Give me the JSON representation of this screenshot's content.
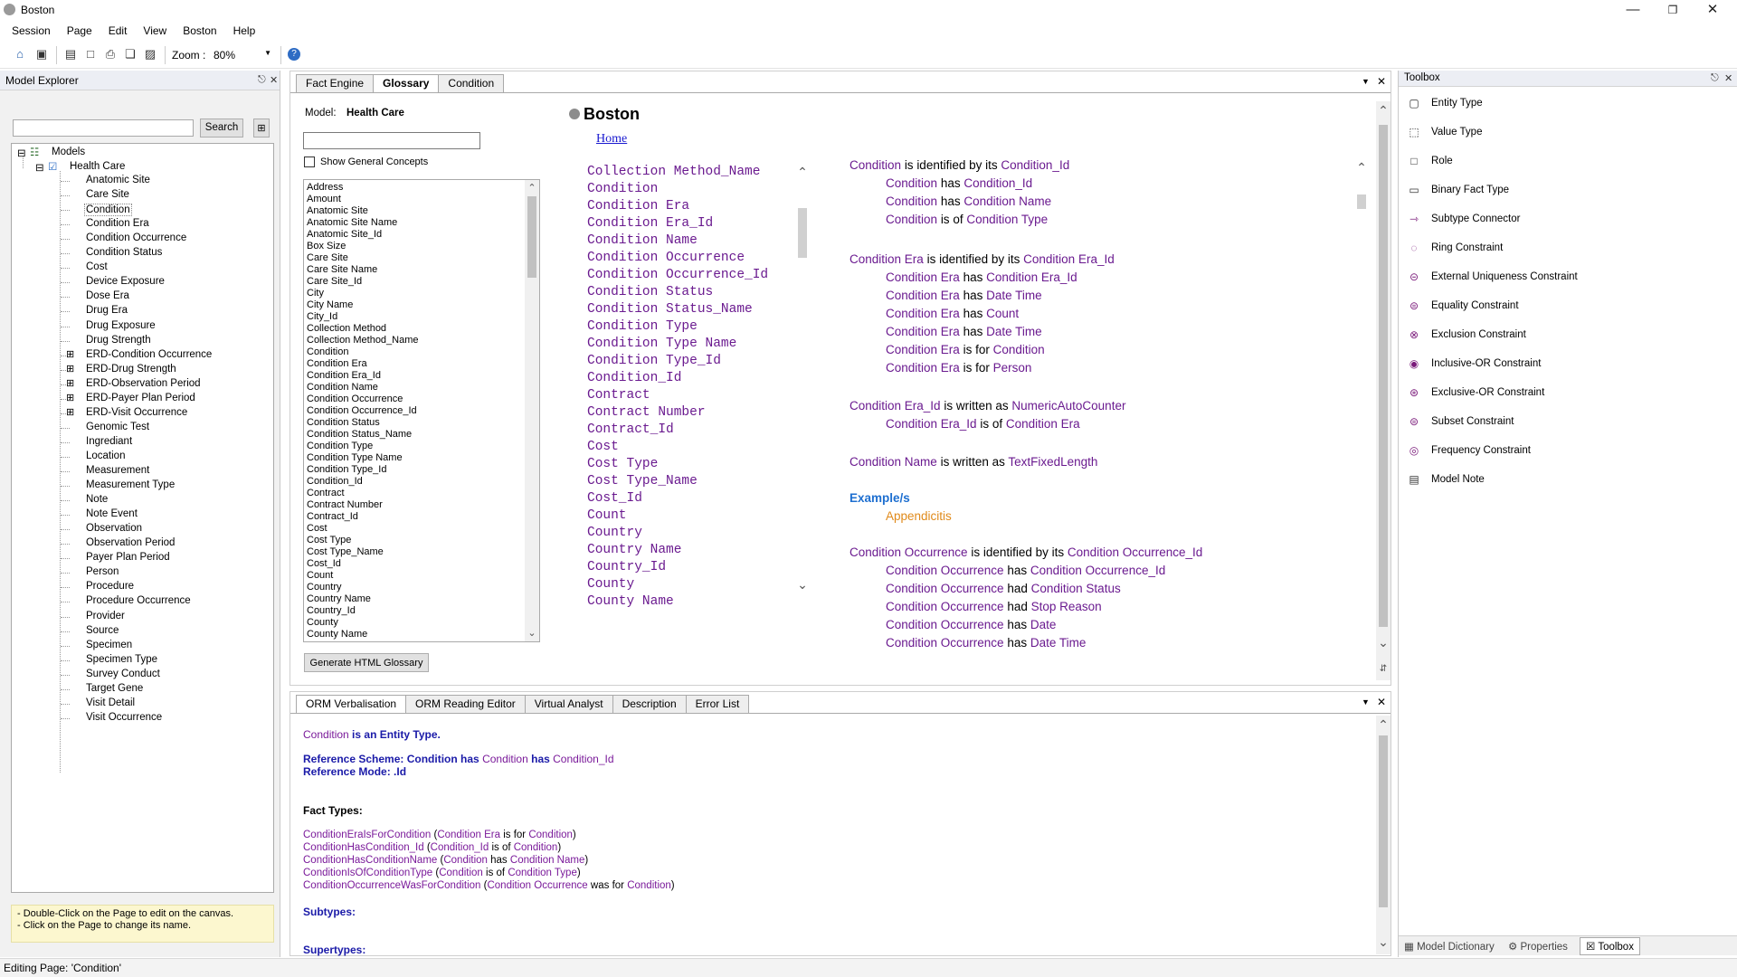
{
  "window": {
    "title": "Boston"
  },
  "menu": [
    "Session",
    "Page",
    "Edit",
    "View",
    "Boston",
    "Help"
  ],
  "toolbar": {
    "zoom_label": "Zoom :",
    "zoom_value": "80%"
  },
  "explorer": {
    "title": "Model Explorer",
    "search_button": "Search",
    "search_value": "",
    "root": "Models",
    "model": "Health Care",
    "items": [
      {
        "label": "Anatomic Site",
        "erd": false
      },
      {
        "label": "Care Site",
        "erd": false
      },
      {
        "label": "Condition",
        "erd": false
      },
      {
        "label": "Condition Era",
        "erd": false
      },
      {
        "label": "Condition Occurrence",
        "erd": false
      },
      {
        "label": "Condition Status",
        "erd": false
      },
      {
        "label": "Cost",
        "erd": false
      },
      {
        "label": "Device Exposure",
        "erd": false
      },
      {
        "label": "Dose Era",
        "erd": false
      },
      {
        "label": "Drug Era",
        "erd": false
      },
      {
        "label": "Drug Exposure",
        "erd": false
      },
      {
        "label": "Drug Strength",
        "erd": false
      },
      {
        "label": "ERD-Condition Occurrence",
        "erd": true
      },
      {
        "label": "ERD-Drug Strength",
        "erd": true
      },
      {
        "label": "ERD-Observation Period",
        "erd": true
      },
      {
        "label": "ERD-Payer Plan Period",
        "erd": true
      },
      {
        "label": "ERD-Visit Occurrence",
        "erd": true
      },
      {
        "label": "Genomic Test",
        "erd": false
      },
      {
        "label": "Ingrediant",
        "erd": false
      },
      {
        "label": "Location",
        "erd": false
      },
      {
        "label": "Measurement",
        "erd": false
      },
      {
        "label": "Measurement Type",
        "erd": false
      },
      {
        "label": "Note",
        "erd": false
      },
      {
        "label": "Note Event",
        "erd": false
      },
      {
        "label": "Observation",
        "erd": false
      },
      {
        "label": "Observation Period",
        "erd": false
      },
      {
        "label": "Payer Plan Period",
        "erd": false
      },
      {
        "label": "Person",
        "erd": false
      },
      {
        "label": "Procedure",
        "erd": false
      },
      {
        "label": "Procedure Occurrence",
        "erd": false
      },
      {
        "label": "Provider",
        "erd": false
      },
      {
        "label": "Source",
        "erd": false
      },
      {
        "label": "Specimen",
        "erd": false
      },
      {
        "label": "Specimen Type",
        "erd": false
      },
      {
        "label": "Survey Conduct",
        "erd": false
      },
      {
        "label": "Target Gene",
        "erd": false
      },
      {
        "label": "Visit Detail",
        "erd": false
      },
      {
        "label": "Visit Occurrence",
        "erd": false
      }
    ],
    "hint_1": "- Double-Click on the Page to edit on the canvas.",
    "hint_2": "- Click on the Page to change its name."
  },
  "center_tabs": [
    "Fact Engine",
    "Glossary",
    "Condition"
  ],
  "glossary_panel": {
    "model_label": "Model:",
    "model_value": "Health Care",
    "show_general": "Show General Concepts",
    "concepts": [
      "Address",
      "Amount",
      "Anatomic Site",
      "Anatomic Site Name",
      "Anatomic Site_Id",
      "Box Size",
      "Care Site",
      "Care Site Name",
      "Care Site_Id",
      "City",
      "City Name",
      "City_Id",
      "Collection Method",
      "Collection Method_Name",
      "Condition",
      "Condition Era",
      "Condition Era_Id",
      "Condition Name",
      "Condition Occurrence",
      "Condition Occurrence_Id",
      "Condition Status",
      "Condition Status_Name",
      "Condition Type",
      "Condition Type Name",
      "Condition Type_Id",
      "Condition_Id",
      "Contract",
      "Contract Number",
      "Contract_Id",
      "Cost",
      "Cost Type",
      "Cost Type_Name",
      "Cost_Id",
      "Count",
      "Country",
      "Country Name",
      "Country_Id",
      "County",
      "County Name"
    ],
    "generate_button": "Generate HTML Glossary"
  },
  "glossary": {
    "title": "Boston",
    "home_link": "Home",
    "terms": [
      "Collection Method_Name",
      "Condition",
      "Condition Era",
      "Condition Era_Id",
      "Condition Name",
      "Condition Occurrence",
      "Condition Occurrence_Id",
      "Condition Status",
      "Condition Status_Name",
      "Condition Type",
      "Condition Type Name",
      "Condition Type_Id",
      "Condition_Id",
      "Contract",
      "Contract Number",
      "Contract_Id",
      "Cost",
      "Cost Type",
      "Cost Type_Name",
      "Cost_Id",
      "Count",
      "Country",
      "Country Name",
      "Country_Id",
      "County",
      "County Name"
    ],
    "examples_label": "Example/s",
    "example_value": "Appendicitis"
  },
  "bottom_tabs": [
    "ORM Verbalisation",
    "ORM Reading Editor",
    "Virtual Analyst",
    "Description",
    "Error List"
  ],
  "verbalisation": {
    "subject": "Condition",
    "is_entity": "is an Entity Type.",
    "ref_scheme_label": "Reference Scheme: Condition has",
    "ref_scheme_a": "Condition",
    "ref_scheme_has": "has",
    "ref_scheme_b": "Condition_Id",
    "ref_mode": "Reference Mode: .Id",
    "fact_types_label": "Fact Types:",
    "fact_types": [
      {
        "name": "ConditionEraIsForCondition",
        "a": "Condition Era",
        "verb": "is for",
        "b": "Condition"
      },
      {
        "name": "ConditionHasCondition_Id",
        "a": "Condition_Id",
        "verb": "is of",
        "b": "Condition"
      },
      {
        "name": "ConditionHasConditionName",
        "a": "Condition",
        "verb": "has",
        "b": "Condition Name"
      },
      {
        "name": "ConditionIsOfConditionType",
        "a": "Condition",
        "verb": "is of",
        "b": "Condition Type"
      },
      {
        "name": "ConditionOccurrenceWasForCondition",
        "a": "Condition Occurrence",
        "verb": "was for",
        "b": "Condition"
      }
    ],
    "subtypes_label": "Subtypes:",
    "supertypes_label": "Supertypes:"
  },
  "toolbox": {
    "title": "Toolbox",
    "tools": [
      "Entity Type",
      "Value Type",
      "Role",
      "Binary Fact Type",
      "Subtype Connector",
      "Ring Constraint",
      "External Uniqueness Constraint",
      "Equality Constraint",
      "Exclusion Constraint",
      "Inclusive-OR Constraint",
      "Exclusive-OR Constraint",
      "Subset Constraint",
      "Frequency Constraint",
      "Model Note"
    ],
    "bottom_tabs": [
      "Model Dictionary",
      "Properties",
      "Toolbox"
    ]
  },
  "status": "Editing Page: 'Condition'"
}
